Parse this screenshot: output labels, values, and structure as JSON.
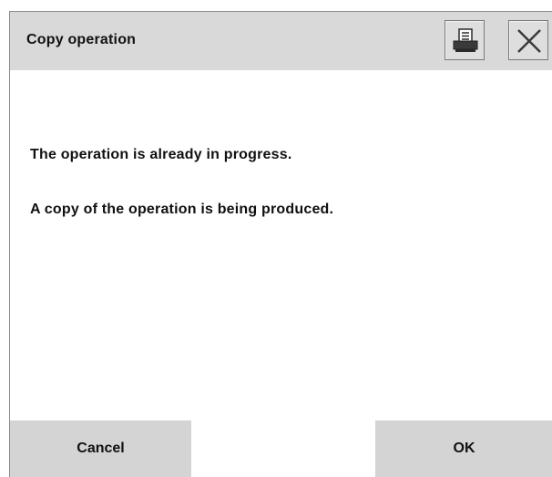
{
  "dialog": {
    "title": "Copy operation",
    "messages": [
      "The operation is already in progress.",
      "A copy of the operation is being produced."
    ],
    "buttons": {
      "cancel_label": "Cancel",
      "ok_label": "OK"
    },
    "header_icons": [
      "printer-icon",
      "close-icon"
    ]
  },
  "colors": {
    "titlebar_bg": "#d9d9d9",
    "button_bg": "#d4d4d4",
    "body_bg": "#ffffff",
    "text": "#111111"
  }
}
